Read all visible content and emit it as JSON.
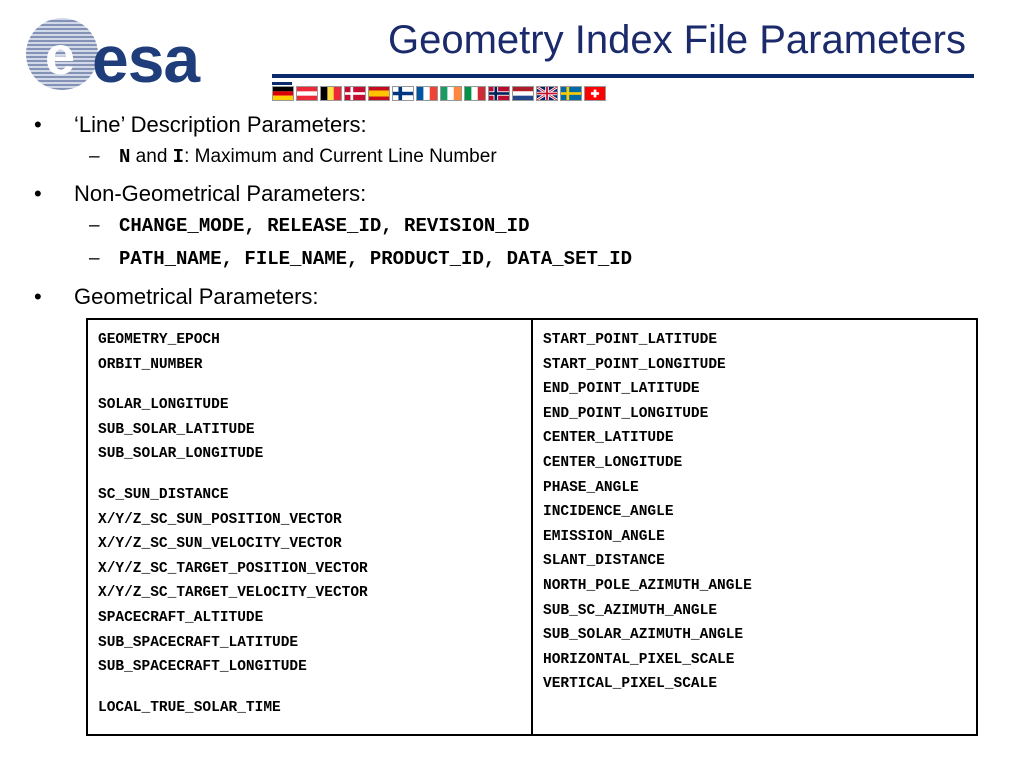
{
  "header": {
    "logo_text": "esa",
    "title": "Geometry Index File Parameters",
    "flags": [
      "germany-flag",
      "austria-flag",
      "belgium-flag",
      "denmark-flag",
      "spain-flag",
      "finland-flag",
      "france-flag",
      "ireland-flag",
      "italy-flag",
      "norway-flag",
      "netherlands-flag",
      "uk-flag",
      "sweden-flag",
      "switzerland-flag"
    ]
  },
  "bullets": {
    "line_desc": "‘Line’ Description Parameters:",
    "line_sub_n": "N",
    "line_sub_and": " and ",
    "line_sub_i": "I",
    "line_sub_rest": ": Maximum and Current Line Number",
    "nongeo": "Non-Geometrical Parameters:",
    "nongeo_sub1": "CHANGE_MODE, RELEASE_ID, REVISION_ID",
    "nongeo_sub2": "PATH_NAME, FILE_NAME, PRODUCT_ID, DATA_SET_ID",
    "geo": "Geometrical Parameters:"
  },
  "table": {
    "left": [
      "GEOMETRY_EPOCH",
      "ORBIT_NUMBER",
      "SOLAR_LONGITUDE",
      "SUB_SOLAR_LATITUDE",
      "SUB_SOLAR_LONGITUDE",
      "SC_SUN_DISTANCE",
      "X/Y/Z_SC_SUN_POSITION_VECTOR",
      "X/Y/Z_SC_SUN_VELOCITY_VECTOR",
      "X/Y/Z_SC_TARGET_POSITION_VECTOR",
      "X/Y/Z_SC_TARGET_VELOCITY_VECTOR",
      "SPACECRAFT_ALTITUDE",
      "SUB_SPACECRAFT_LATITUDE",
      "SUB_SPACECRAFT_LONGITUDE",
      "LOCAL_TRUE_SOLAR_TIME"
    ],
    "right": [
      "START_POINT_LATITUDE",
      "START_POINT_LONGITUDE",
      "END_POINT_LATITUDE",
      "END_POINT_LONGITUDE",
      "CENTER_LATITUDE",
      "CENTER_LONGITUDE",
      "PHASE_ANGLE",
      "INCIDENCE_ANGLE",
      "EMISSION_ANGLE",
      "SLANT_DISTANCE",
      "NORTH_POLE_AZIMUTH_ANGLE",
      "SUB_SC_AZIMUTH_ANGLE",
      "SUB_SOLAR_AZIMUTH_ANGLE",
      "HORIZONTAL_PIXEL_SCALE",
      "VERTICAL_PIXEL_SCALE"
    ]
  }
}
